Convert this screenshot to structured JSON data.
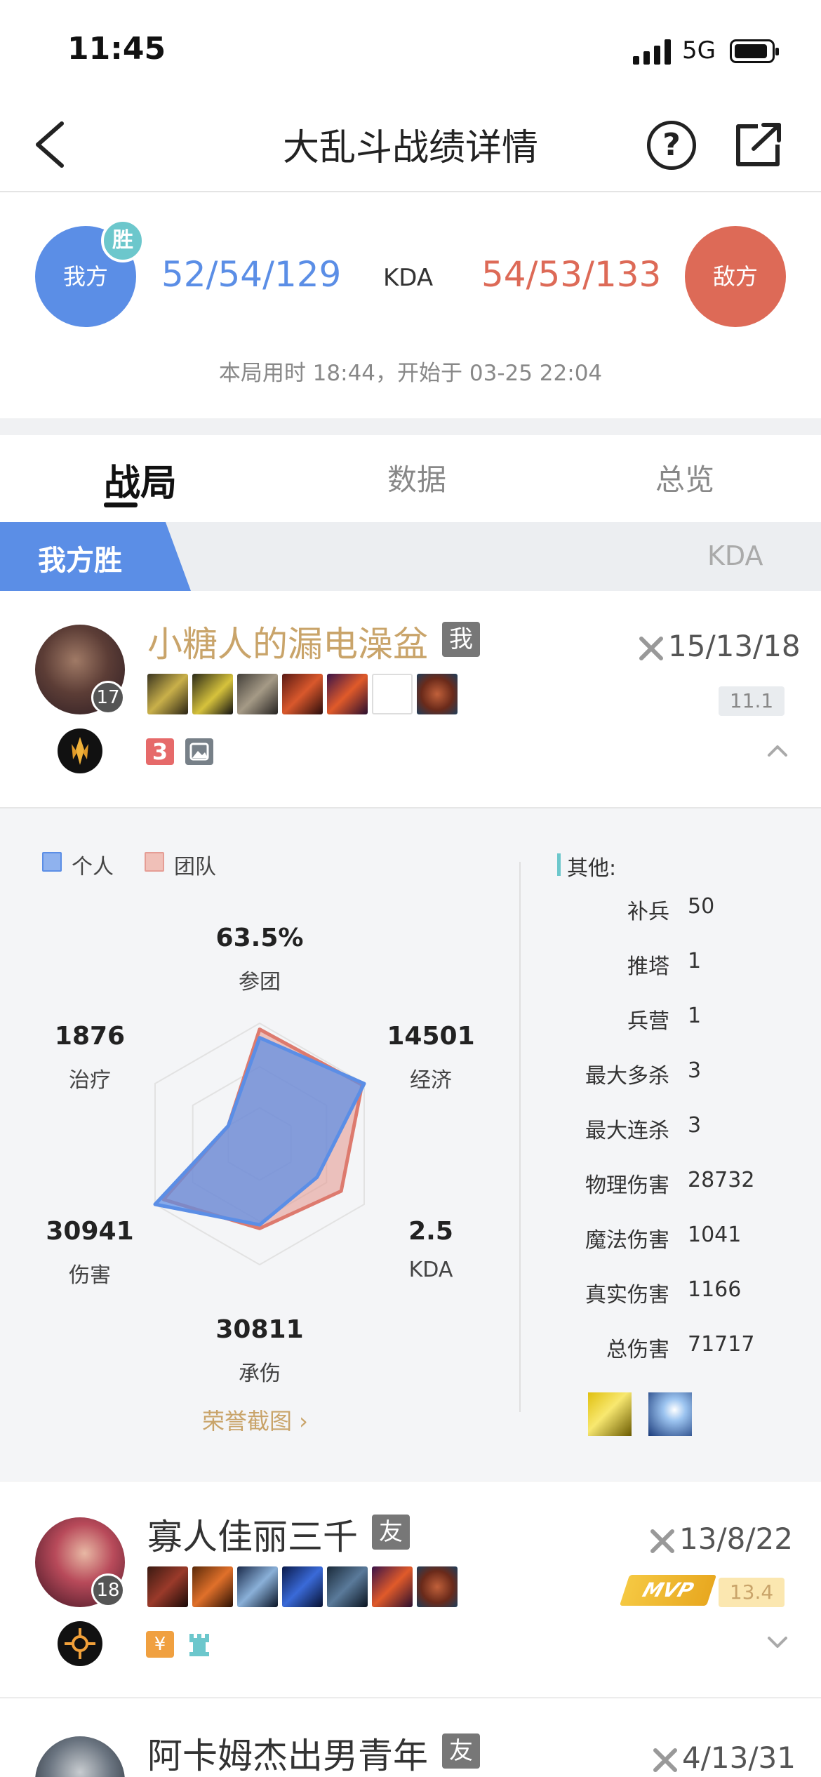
{
  "status_bar": {
    "time": "11:45",
    "network": "5G"
  },
  "nav": {
    "title": "大乱斗战绩详情"
  },
  "score": {
    "my_team": "我方",
    "my_badge": "胜",
    "my_kda": "52/54/129",
    "kda_label": "KDA",
    "enemy_kda": "54/53/133",
    "enemy_team": "敌方",
    "game_info": "本局用时 18:44，开始于 03-25 22:04"
  },
  "tabs": [
    {
      "label": "战局"
    },
    {
      "label": "数据"
    },
    {
      "label": "总览"
    }
  ],
  "section": {
    "result": "我方胜",
    "kda_header": "KDA"
  },
  "players": [
    {
      "name": "小糖人的漏电澡盆",
      "tag": "我",
      "level": "17",
      "kda": "15/13/18",
      "score": "11.1",
      "badge_number": "3"
    },
    {
      "name": "寡人佳丽三千",
      "tag": "友",
      "level": "18",
      "kda": "13/8/22",
      "score": "13.4",
      "mvp": "MVP"
    },
    {
      "name": "阿卡姆杰出男青年",
      "tag": "友",
      "kda": "4/13/31"
    }
  ],
  "radar": {
    "legend_personal": "个人",
    "legend_team": "团队",
    "axes": [
      {
        "value": "63.5%",
        "label": "参团"
      },
      {
        "value": "14501",
        "label": "经济"
      },
      {
        "value": "2.5",
        "label": "KDA"
      },
      {
        "value": "30811",
        "label": "承伤"
      },
      {
        "value": "30941",
        "label": "伤害"
      },
      {
        "value": "1876",
        "label": "治疗"
      }
    ],
    "personal_fraction": [
      0.88,
      1.0,
      0.55,
      0.67,
      1.0,
      0.3
    ],
    "team_fraction": [
      0.95,
      0.98,
      0.78,
      0.7,
      0.92,
      0.3
    ],
    "personal_color": "#5b8ee6",
    "team_color": "#e59d95",
    "honor_link": "荣誉截图 ›"
  },
  "other": {
    "title": "其他:",
    "stats": [
      {
        "label": "补兵",
        "value": "50"
      },
      {
        "label": "推塔",
        "value": "1"
      },
      {
        "label": "兵营",
        "value": "1"
      },
      {
        "label": "最大多杀",
        "value": "3"
      },
      {
        "label": "最大连杀",
        "value": "3"
      },
      {
        "label": "物理伤害",
        "value": "28732"
      },
      {
        "label": "魔法伤害",
        "value": "1041"
      },
      {
        "label": "真实伤害",
        "value": "1166"
      },
      {
        "label": "总伤害",
        "value": "71717"
      }
    ]
  },
  "colors": {
    "blue": "#5b8ee6",
    "red": "#dd6a57",
    "gold": "#c9a46a",
    "teal": "#6cc7cc"
  }
}
